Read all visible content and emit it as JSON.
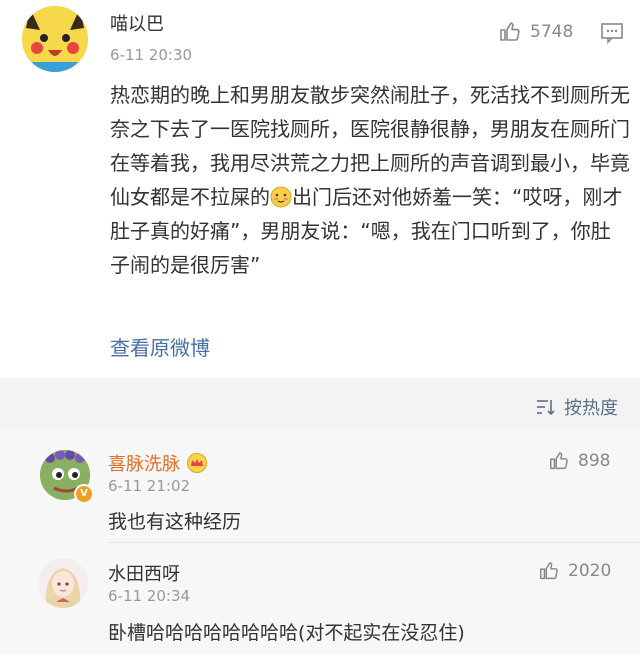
{
  "post": {
    "author": "喵以巴",
    "time": "6-11 20:30",
    "like_count": "5748",
    "text_part1": "热恋期的晚上和男朋友散步突然闹肚子，死活找不到厕所无奈之下去了一医院找厕所，医院很静很静，男朋友在厕所门在等着我，我用尽洪荒之力把上厕所的声音调到最小，毕竟仙女都是不拉屎的",
    "text_part2": "出门后还对他娇羞一笑：“哎呀，刚才肚子真的好痛”，男朋友说：“嗯，我在门口听到了，你肚子闹的是很厉害”",
    "view_original": "查看原微博"
  },
  "sort": {
    "label": "按热度"
  },
  "comments": [
    {
      "name": "喜脉洗脉",
      "time": "6-11 21:02",
      "likes": "898",
      "text": "我也有这种经历"
    },
    {
      "name": "水田西呀",
      "time": "6-11 20:34",
      "likes": "2020",
      "text": "卧槽哈哈哈哈哈哈哈哈(对不起实在没忍住)"
    }
  ],
  "colors": {
    "link": "#4a6ea3",
    "vip_name": "#e86c1f",
    "sort": "#5b6f86",
    "background_gray": "#f7f7f7"
  },
  "icons": [
    "pikachu-avatar",
    "thumb-up-icon",
    "comment-icon",
    "sort-icon",
    "crown-icon",
    "verified-badge",
    "blush-emoji"
  ]
}
